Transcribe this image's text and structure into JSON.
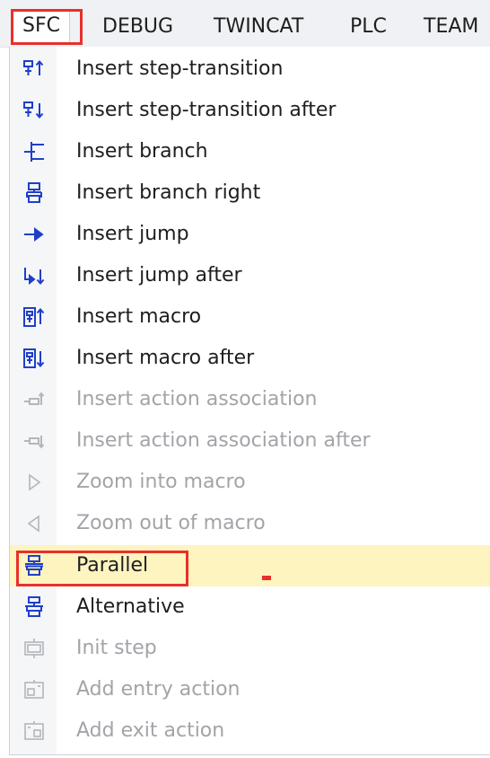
{
  "menubar": {
    "items": [
      {
        "label": "SFC",
        "active": true
      },
      {
        "label": "DEBUG"
      },
      {
        "label": "TWINCAT"
      },
      {
        "label": "PLC"
      },
      {
        "label": "TEAM"
      }
    ]
  },
  "menu": {
    "items": [
      {
        "label": "Insert step-transition",
        "icon": "step-transition-before-icon",
        "enabled": true
      },
      {
        "label": "Insert step-transition after",
        "icon": "step-transition-after-icon",
        "enabled": true
      },
      {
        "label": "Insert branch",
        "icon": "branch-icon",
        "enabled": true
      },
      {
        "label": "Insert branch right",
        "icon": "branch-right-icon",
        "enabled": true
      },
      {
        "label": "Insert jump",
        "icon": "jump-icon",
        "enabled": true
      },
      {
        "label": "Insert jump after",
        "icon": "jump-after-icon",
        "enabled": true
      },
      {
        "label": "Insert macro",
        "icon": "macro-before-icon",
        "enabled": true
      },
      {
        "label": "Insert macro after",
        "icon": "macro-after-icon",
        "enabled": true
      },
      {
        "label": "Insert action association",
        "icon": "action-association-icon",
        "enabled": false
      },
      {
        "label": "Insert action association after",
        "icon": "action-association-after-icon",
        "enabled": false
      },
      {
        "label": "Zoom into macro",
        "icon": "zoom-into-macro-icon",
        "enabled": false
      },
      {
        "label": "Zoom out of macro",
        "icon": "zoom-out-macro-icon",
        "enabled": false
      },
      {
        "label": "Parallel",
        "icon": "parallel-icon",
        "enabled": true,
        "highlighted": true
      },
      {
        "label": "Alternative",
        "icon": "alternative-icon",
        "enabled": true
      },
      {
        "label": "Init step",
        "icon": "init-step-icon",
        "enabled": false
      },
      {
        "label": "Add entry action",
        "icon": "entry-action-icon",
        "enabled": false
      },
      {
        "label": "Add exit action",
        "icon": "exit-action-icon",
        "enabled": false
      }
    ]
  },
  "colors": {
    "icon_blue": "#1f3fc9",
    "icon_disabled": "#b4b6bb",
    "highlight": "#fdf4bf",
    "annotation": "#e8302a"
  }
}
